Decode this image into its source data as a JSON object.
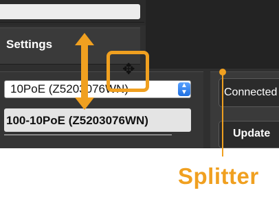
{
  "settings": {
    "label": "Settings"
  },
  "ethernet": {
    "selected_option": "10PoE (Z5203076WN)",
    "full_name": "100-10PoE (Z5203076WN)"
  },
  "buttons": {
    "connected": "Connected",
    "update": "Update"
  },
  "annotation": {
    "label": "Splitter",
    "color": "#f0a020"
  },
  "icons": {
    "move": "move-cursor-icon",
    "resize": "vertical-resize-arrow-icon",
    "select": "select-arrows-icon"
  }
}
